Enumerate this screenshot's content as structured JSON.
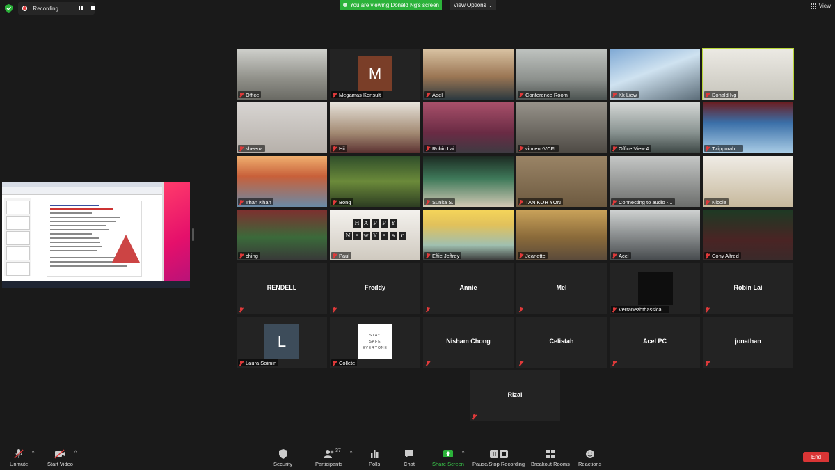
{
  "recording": {
    "label": "Recording..."
  },
  "banner": {
    "viewing": "You are viewing Donald Ng's screen",
    "view_options": "View Options"
  },
  "view_button": {
    "label": "View"
  },
  "colors": {
    "active_speaker": "#b9d73a",
    "share_green": "#2bb23a",
    "end_red": "#d93535",
    "muted_red": "#e03a3a"
  },
  "participants": [
    {
      "name": "Office",
      "kind": "video"
    },
    {
      "name": "Megamas Konsult",
      "kind": "avatar",
      "initial": "M"
    },
    {
      "name": "Adel",
      "kind": "video"
    },
    {
      "name": "Conference Room",
      "kind": "video"
    },
    {
      "name": "Kk Liew",
      "kind": "video"
    },
    {
      "name": "Donald Ng",
      "kind": "video",
      "active": true
    },
    {
      "name": "sheena",
      "kind": "video"
    },
    {
      "name": "Hii",
      "kind": "video"
    },
    {
      "name": "Robin Lai",
      "kind": "video"
    },
    {
      "name": "vincent-VCFL",
      "kind": "video"
    },
    {
      "name": "Office View A",
      "kind": "video"
    },
    {
      "name": "Tzipporah ...",
      "kind": "video"
    },
    {
      "name": "Irhan Khan",
      "kind": "video"
    },
    {
      "name": "Bong",
      "kind": "video"
    },
    {
      "name": "Sunita S.",
      "kind": "video"
    },
    {
      "name": "TAN KOH YON",
      "kind": "video"
    },
    {
      "name": "Connecting to audio -...",
      "kind": "video"
    },
    {
      "name": "Nicole",
      "kind": "video"
    },
    {
      "name": "ching",
      "kind": "video"
    },
    {
      "name": "Paul",
      "kind": "video",
      "banner": [
        "H",
        "A",
        "P",
        "P",
        "Y"
      ],
      "banner2": [
        "N",
        "e",
        "w",
        "Y",
        "e",
        "a",
        "r"
      ]
    },
    {
      "name": "Effie Jeffrey",
      "kind": "video"
    },
    {
      "name": "Jeanette",
      "kind": "video"
    },
    {
      "name": "Acel",
      "kind": "video"
    },
    {
      "name": "Cony Alfred",
      "kind": "video"
    },
    {
      "name": "RENDELL",
      "kind": "name"
    },
    {
      "name": "Freddy",
      "kind": "name"
    },
    {
      "name": "Annie",
      "kind": "name"
    },
    {
      "name": "Mel",
      "kind": "name"
    },
    {
      "name": "Verranezhthassica ...",
      "kind": "mini"
    },
    {
      "name": "Robin Lai",
      "kind": "name"
    },
    {
      "name": "Laura Soimin",
      "kind": "avatar",
      "initial": "L"
    },
    {
      "name": "Collete",
      "kind": "card",
      "card_lines": [
        "STAY",
        "SAFE",
        "EVERYONE"
      ]
    },
    {
      "name": "Nisham Chong",
      "kind": "name"
    },
    {
      "name": "Celistah",
      "kind": "name"
    },
    {
      "name": "Acel PC",
      "kind": "name"
    },
    {
      "name": "jonathan",
      "kind": "name"
    },
    {
      "name": "Rizal",
      "kind": "name"
    }
  ],
  "toolbar": {
    "unmute": "Unmute",
    "start_video": "Start Video",
    "security": "Security",
    "participants": "Participants",
    "participants_count": "37",
    "polls": "Polls",
    "chat": "Chat",
    "share_screen": "Share Screen",
    "pause_stop_recording": "Pause/Stop Recording",
    "breakout_rooms": "Breakout Rooms",
    "reactions": "Reactions",
    "end": "End"
  }
}
